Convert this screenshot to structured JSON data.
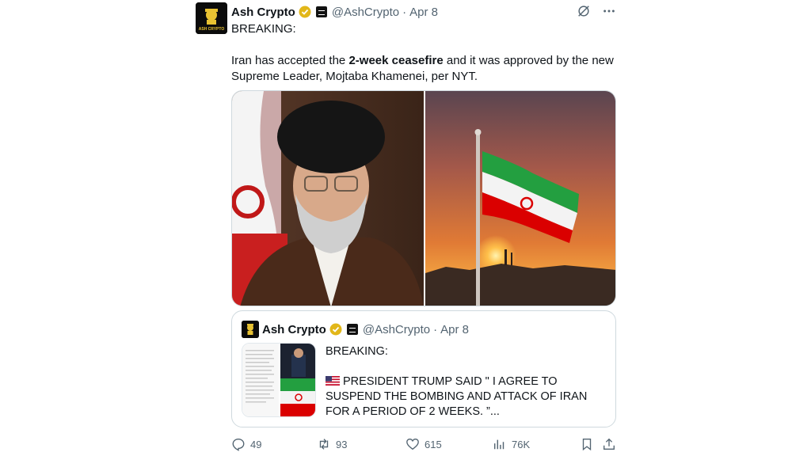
{
  "post": {
    "author_name": "Ash Crypto",
    "author_handle": "@AshCrypto",
    "separator": "·",
    "date": "Apr 8",
    "text_line1": "BREAKING:",
    "text_pre": "Iran has accepted the ",
    "text_bold": "2-week ceasefire",
    "text_post": " and it was approved by the new Supreme Leader, Mojtaba Khamenei, per NYT.",
    "avatar_text": "ASH CRYPTO"
  },
  "quote": {
    "author_name": "Ash Crypto",
    "author_handle": "@AshCrypto",
    "separator": "·",
    "date": "Apr 8",
    "line1": "BREAKING:",
    "line2": "PRESIDENT TRUMP SAID \" I AGREE TO SUSPEND THE BOMBING AND ATTACK OF IRAN FOR A PERIOD OF 2 WEEKS. ”..."
  },
  "actions": {
    "replies": "49",
    "reposts": "93",
    "likes": "615",
    "views": "76K"
  },
  "colors": {
    "verified": "#e2b719",
    "muted": "#536471",
    "border": "#cfd9de",
    "iran_green": "#239f40",
    "iran_red": "#da0000"
  },
  "icons": [
    "verified-badge-icon",
    "affiliate-badge-icon",
    "grok-icon",
    "more-icon",
    "reply-icon",
    "repost-icon",
    "like-icon",
    "views-icon",
    "bookmark-icon",
    "share-icon",
    "us-flag-icon"
  ]
}
